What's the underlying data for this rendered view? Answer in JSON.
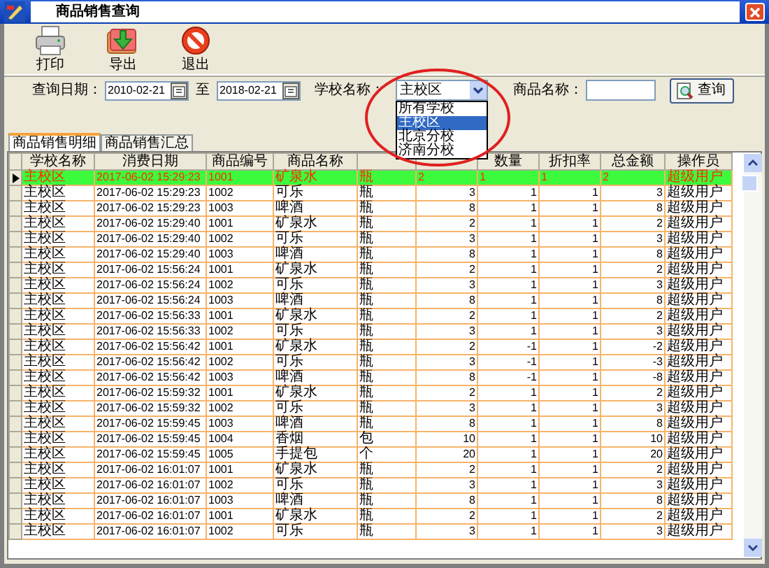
{
  "window": {
    "title": "商品销售查询"
  },
  "toolbar": [
    {
      "kind": "print",
      "label": "打印"
    },
    {
      "kind": "export",
      "label": "导出"
    },
    {
      "kind": "exit",
      "label": "退出"
    }
  ],
  "filters": {
    "date_label": "查询日期：",
    "date_from": "2010-02-21",
    "date_sep": "至",
    "date_to": "2018-02-21",
    "school_label": "学校名称：",
    "school_value": "主校区",
    "school_options": [
      {
        "label": "所有学校",
        "selected": false
      },
      {
        "label": "主校区",
        "selected": true
      },
      {
        "label": "北京分校",
        "selected": false
      },
      {
        "label": "济南分校",
        "selected": false
      }
    ],
    "product_label": "商品名称：",
    "query_button": "查询"
  },
  "tabs": [
    {
      "label": "商品销售明细",
      "selected": true
    },
    {
      "label": "商品销售汇总",
      "selected": false
    }
  ],
  "table": {
    "columns": [
      {
        "label": "学校名称"
      },
      {
        "label": "消费日期"
      },
      {
        "label": "商品编号"
      },
      {
        "label": "商品名称"
      },
      {},
      {},
      {
        "label": "数量"
      },
      {
        "label": "折扣率"
      },
      {
        "label": "总金额"
      },
      {
        "label": "操作员"
      }
    ],
    "rows": [
      {
        "selected": true,
        "cells": [
          "主校区",
          "2017-06-02 15:29:23",
          "1001",
          "矿泉水",
          "瓶",
          "2",
          "1",
          "1",
          "2",
          "超级用户"
        ]
      },
      {
        "selected": false,
        "cells": [
          "主校区",
          "2017-06-02 15:29:23",
          "1002",
          "可乐",
          "瓶",
          "3",
          "1",
          "1",
          "3",
          "超级用户"
        ]
      },
      {
        "selected": false,
        "cells": [
          "主校区",
          "2017-06-02 15:29:23",
          "1003",
          "啤酒",
          "瓶",
          "8",
          "1",
          "1",
          "8",
          "超级用户"
        ]
      },
      {
        "selected": false,
        "cells": [
          "主校区",
          "2017-06-02 15:29:40",
          "1001",
          "矿泉水",
          "瓶",
          "2",
          "1",
          "1",
          "2",
          "超级用户"
        ]
      },
      {
        "selected": false,
        "cells": [
          "主校区",
          "2017-06-02 15:29:40",
          "1002",
          "可乐",
          "瓶",
          "3",
          "1",
          "1",
          "3",
          "超级用户"
        ]
      },
      {
        "selected": false,
        "cells": [
          "主校区",
          "2017-06-02 15:29:40",
          "1003",
          "啤酒",
          "瓶",
          "8",
          "1",
          "1",
          "8",
          "超级用户"
        ]
      },
      {
        "selected": false,
        "cells": [
          "主校区",
          "2017-06-02 15:56:24",
          "1001",
          "矿泉水",
          "瓶",
          "2",
          "1",
          "1",
          "2",
          "超级用户"
        ]
      },
      {
        "selected": false,
        "cells": [
          "主校区",
          "2017-06-02 15:56:24",
          "1002",
          "可乐",
          "瓶",
          "3",
          "1",
          "1",
          "3",
          "超级用户"
        ]
      },
      {
        "selected": false,
        "cells": [
          "主校区",
          "2017-06-02 15:56:24",
          "1003",
          "啤酒",
          "瓶",
          "8",
          "1",
          "1",
          "8",
          "超级用户"
        ]
      },
      {
        "selected": false,
        "cells": [
          "主校区",
          "2017-06-02 15:56:33",
          "1001",
          "矿泉水",
          "瓶",
          "2",
          "1",
          "1",
          "2",
          "超级用户"
        ]
      },
      {
        "selected": false,
        "cells": [
          "主校区",
          "2017-06-02 15:56:33",
          "1002",
          "可乐",
          "瓶",
          "3",
          "1",
          "1",
          "3",
          "超级用户"
        ]
      },
      {
        "selected": false,
        "cells": [
          "主校区",
          "2017-06-02 15:56:42",
          "1001",
          "矿泉水",
          "瓶",
          "2",
          "-1",
          "1",
          "-2",
          "超级用户"
        ]
      },
      {
        "selected": false,
        "cells": [
          "主校区",
          "2017-06-02 15:56:42",
          "1002",
          "可乐",
          "瓶",
          "3",
          "-1",
          "1",
          "-3",
          "超级用户"
        ]
      },
      {
        "selected": false,
        "cells": [
          "主校区",
          "2017-06-02 15:56:42",
          "1003",
          "啤酒",
          "瓶",
          "8",
          "-1",
          "1",
          "-8",
          "超级用户"
        ]
      },
      {
        "selected": false,
        "cells": [
          "主校区",
          "2017-06-02 15:59:32",
          "1001",
          "矿泉水",
          "瓶",
          "2",
          "1",
          "1",
          "2",
          "超级用户"
        ]
      },
      {
        "selected": false,
        "cells": [
          "主校区",
          "2017-06-02 15:59:32",
          "1002",
          "可乐",
          "瓶",
          "3",
          "1",
          "1",
          "3",
          "超级用户"
        ]
      },
      {
        "selected": false,
        "cells": [
          "主校区",
          "2017-06-02 15:59:45",
          "1003",
          "啤酒",
          "瓶",
          "8",
          "1",
          "1",
          "8",
          "超级用户"
        ]
      },
      {
        "selected": false,
        "cells": [
          "主校区",
          "2017-06-02 15:59:45",
          "1004",
          "香烟",
          "包",
          "10",
          "1",
          "1",
          "10",
          "超级用户"
        ]
      },
      {
        "selected": false,
        "cells": [
          "主校区",
          "2017-06-02 15:59:45",
          "1005",
          "手提包",
          "个",
          "20",
          "1",
          "1",
          "20",
          "超级用户"
        ]
      },
      {
        "selected": false,
        "cells": [
          "主校区",
          "2017-06-02 16:01:07",
          "1001",
          "矿泉水",
          "瓶",
          "2",
          "1",
          "1",
          "2",
          "超级用户"
        ]
      },
      {
        "selected": false,
        "cells": [
          "主校区",
          "2017-06-02 16:01:07",
          "1002",
          "可乐",
          "瓶",
          "3",
          "1",
          "1",
          "3",
          "超级用户"
        ]
      },
      {
        "selected": false,
        "cells": [
          "主校区",
          "2017-06-02 16:01:07",
          "1003",
          "啤酒",
          "瓶",
          "8",
          "1",
          "1",
          "8",
          "超级用户"
        ]
      },
      {
        "selected": false,
        "cells": [
          "主校区",
          "2017-06-02 16:01:07",
          "1001",
          "矿泉水",
          "瓶",
          "2",
          "1",
          "1",
          "2",
          "超级用户"
        ]
      },
      {
        "selected": false,
        "cells": [
          "主校区",
          "2017-06-02 16:01:07",
          "1002",
          "可乐",
          "瓶",
          "3",
          "1",
          "1",
          "3",
          "超级用户"
        ]
      }
    ]
  }
}
